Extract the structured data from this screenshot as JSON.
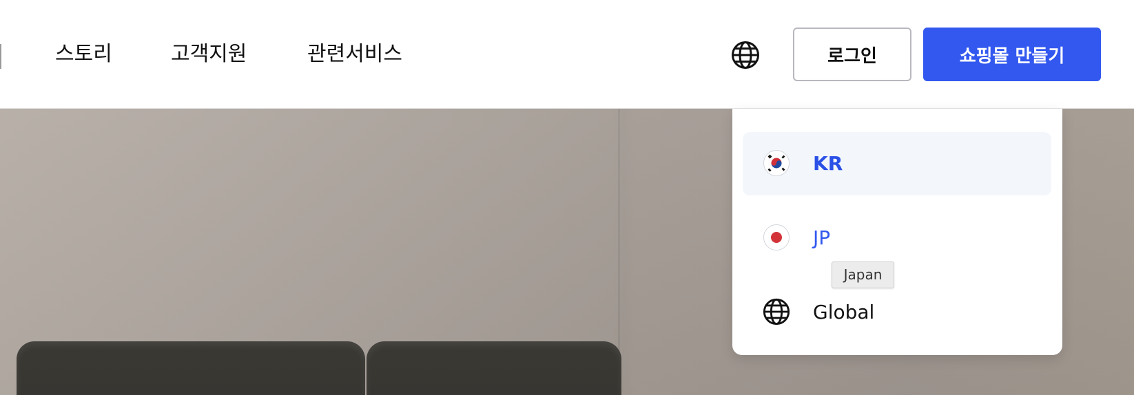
{
  "header": {
    "nav": [
      "스토리",
      "고객지원",
      "관련서비스"
    ],
    "globe_icon": "globe-icon",
    "login_label": "로그인",
    "cta_label": "쇼핑몰 만들기",
    "accent_color": "#3258ef"
  },
  "language_menu": {
    "options": [
      {
        "code": "KR",
        "icon": "korea-flag-icon",
        "selected": true
      },
      {
        "code": "JP",
        "icon": "japan-flag-icon",
        "selected": false
      },
      {
        "code": "Global",
        "icon": "globe-icon",
        "selected": false
      }
    ],
    "tooltip": "Japan"
  }
}
